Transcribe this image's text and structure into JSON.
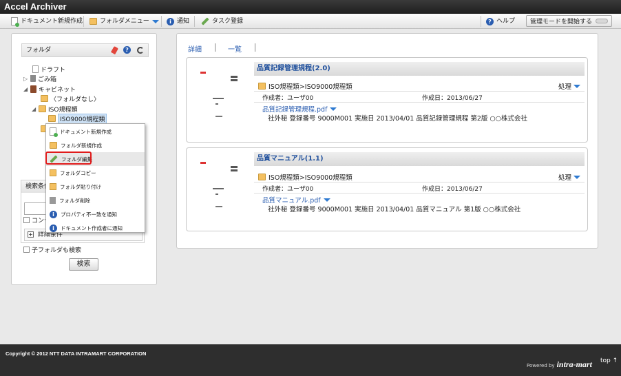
{
  "app": {
    "title": "Accel Archiver"
  },
  "toolbar": {
    "new_doc": "ドキュメント新規作成",
    "folder_menu": "フォルダメニュー",
    "notify": "通知",
    "task": "タスク登録",
    "help": "ヘルプ",
    "admin_mode": "管理モードを開始する"
  },
  "folder_panel": {
    "header": "フォルダ",
    "tree": {
      "draft": "ドラフト",
      "trash": "ごみ箱",
      "cabinet": "キャビネット",
      "no_folder": "〈フォルダなし〉",
      "iso": "ISO規程類",
      "iso9000": "ISO9000規程類"
    }
  },
  "context_menu": {
    "items": [
      "ドキュメント新規作成",
      "フォルダ新規作成",
      "フォルダ編集",
      "フォルダコピー",
      "フォルダ貼り付け",
      "フォルダ削除",
      "プロパティ不一致を通知",
      "ドキュメント作成者に通知"
    ]
  },
  "search": {
    "header": "検索条件",
    "content_label": "コンテ",
    "detail_label": "詳細条件",
    "subfolder_label": "子フォルダも検索",
    "button": "検索"
  },
  "main": {
    "view_detail": "詳細",
    "view_list": "一覧",
    "documents": [
      {
        "title": "品質記録管理規程(2.0)",
        "path": "ISO規程類>ISO9000規程類",
        "action": "処理",
        "author": "作成者：ユーザ00",
        "created": "作成日：2013/06/27",
        "file": "品質記録管理規程.pdf",
        "description": "社外秘 登録番号 9000M001 実施日 2013/04/01 品質記録管理規程 第2版 ○○株式会社"
      },
      {
        "title": "品質マニュアル(1.1)",
        "path": "ISO規程類>ISO9000規程類",
        "action": "処理",
        "author": "作成者：ユーザ00",
        "created": "作成日：2013/06/27",
        "file": "品質マニュアル.pdf",
        "description": "社外秘 登録番号 9000M001 実施日 2013/04/01 品質マニュアル 第1版 ○○株式会社"
      }
    ]
  },
  "footer": {
    "copyright": "Copyright © 2012 NTT DATA INTRAMART CORPORATION",
    "powered": "Powered by",
    "logo": "intra-mart",
    "top": "top ↑"
  },
  "colors": {
    "accent": "#2a5db0",
    "highlight": "#e01b1b"
  }
}
